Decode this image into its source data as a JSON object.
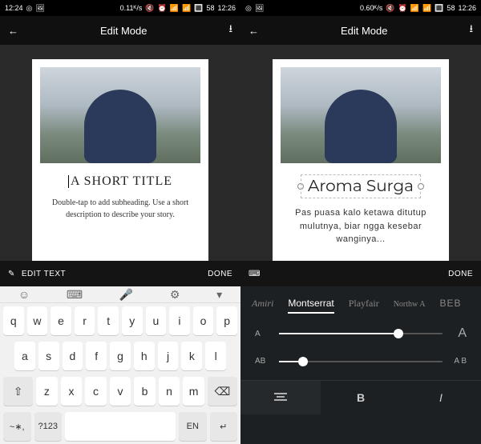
{
  "left": {
    "status": {
      "time": "12:24",
      "speed": "0.11ᴷ/s",
      "battery": "58",
      "clock": "12:26"
    },
    "header": {
      "title": "Edit Mode"
    },
    "card": {
      "title": "A SHORT TITLE",
      "subtitle": "Double-tap to add subheading. Use a short description to describe your story."
    },
    "toolbar": {
      "edit": "EDIT TEXT",
      "done": "DONE"
    },
    "keyboard": {
      "row1": [
        "q",
        "w",
        "e",
        "r",
        "t",
        "y",
        "u",
        "i",
        "o",
        "p"
      ],
      "row2": [
        "a",
        "s",
        "d",
        "f",
        "g",
        "h",
        "j",
        "k",
        "l"
      ],
      "row3": [
        "⇧",
        "z",
        "x",
        "c",
        "v",
        "b",
        "n",
        "m",
        "⌫"
      ],
      "row4_left": "~∗,",
      "row4_num": "?123",
      "row4_lang": "EN",
      "row4_enter": "↵",
      "tb_emoji": "☺",
      "tb_kbd": "⌨",
      "tb_mic": "🎤",
      "tb_cog": "⚙",
      "tb_down": "▾"
    }
  },
  "right": {
    "status": {
      "speed": "0.60ᴷ/s",
      "battery": "58",
      "clock": "12:26"
    },
    "header": {
      "title": "Edit Mode"
    },
    "card": {
      "title": "Aroma Surga",
      "subtitle": "Pas puasa kalo ketawa ditutup mulutnya, biar ngga kesebar wanginya..."
    },
    "toolbar": {
      "done": "DONE"
    },
    "fontpanel": {
      "fonts": {
        "amiri": "Amiri",
        "mont": "Montserrat",
        "play": "Playfair",
        "script": "Northw A",
        "beb": "BEB"
      },
      "size": {
        "small": "A",
        "big": "A",
        "value": 0.7
      },
      "spacing": {
        "small": "AB",
        "big": "A B",
        "value": 0.12
      },
      "align": {
        "bold": "B",
        "italic": "I"
      }
    }
  }
}
